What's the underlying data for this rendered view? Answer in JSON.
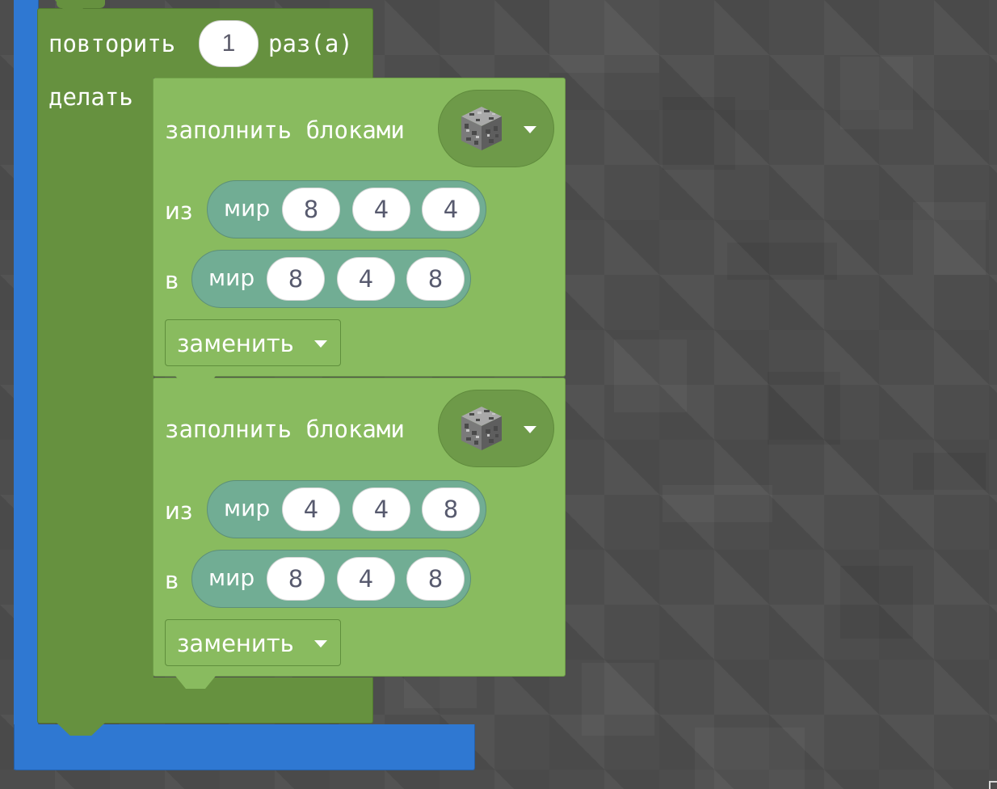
{
  "repeat": {
    "label_repeat": "повторить",
    "count": "1",
    "label_times": "раз(а)",
    "label_do": "делать"
  },
  "fill_blocks": [
    {
      "title": "заполнить блоками",
      "block_icon": "cobblestone-cube-icon",
      "from_label": "из",
      "from_world": "мир",
      "from": [
        "8",
        "4",
        "4"
      ],
      "to_label": "в",
      "to_world": "мир",
      "to": [
        "8",
        "4",
        "8"
      ],
      "mode": "заменить"
    },
    {
      "title": "заполнить блоками",
      "block_icon": "cobblestone-cube-icon",
      "from_label": "из",
      "from_world": "мир",
      "from": [
        "4",
        "4",
        "8"
      ],
      "to_label": "в",
      "to_world": "мир",
      "to": [
        "8",
        "4",
        "8"
      ],
      "mode": "заменить"
    }
  ],
  "colors": {
    "outer_block": "#2f78d2",
    "repeat_block": "#66913f",
    "fill_block": "#89bb5f",
    "position_pill": "#71ad94",
    "workspace": "#4d4d4d"
  }
}
